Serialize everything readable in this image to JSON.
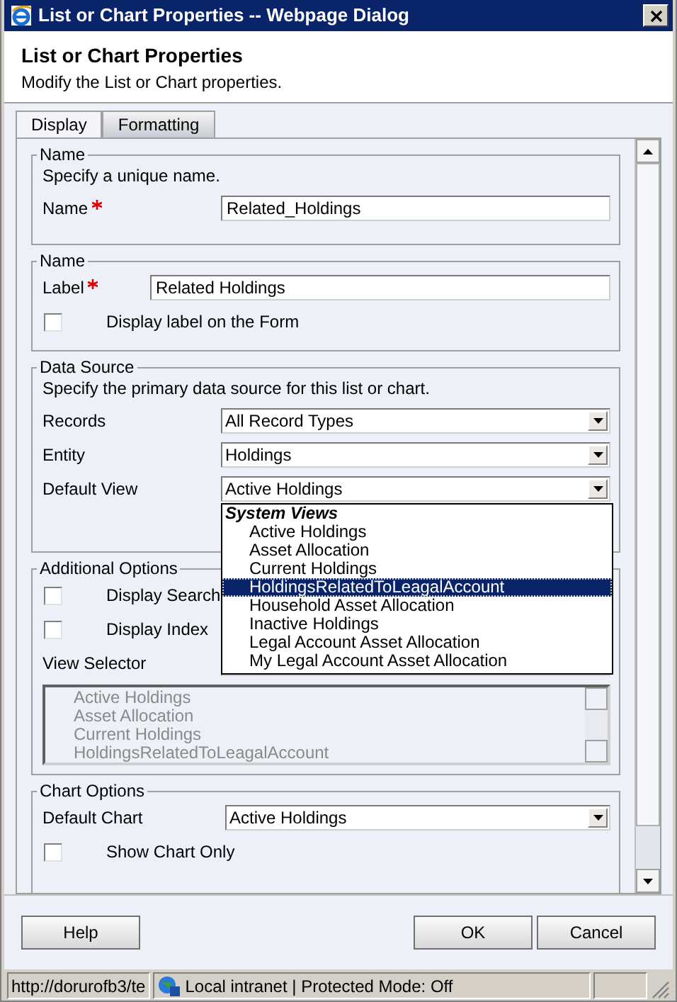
{
  "window": {
    "title": "List or Chart Properties -- Webpage Dialog"
  },
  "header": {
    "title": "List or Chart Properties",
    "subtitle": "Modify the List or Chart properties."
  },
  "tabs": [
    {
      "label": "Display",
      "selected": true
    },
    {
      "label": "Formatting",
      "selected": false
    }
  ],
  "sections": [
    {
      "legend": "Name",
      "description": "Specify a unique name.",
      "rows": [
        {
          "kind": "input",
          "label": "Name",
          "required": true,
          "value": "Related_Holdings"
        }
      ]
    },
    {
      "legend": "Name",
      "rows": [
        {
          "kind": "input",
          "label": "Label",
          "required": true,
          "value": "Related Holdings"
        },
        {
          "kind": "checkbox",
          "label": "Display label on the Form",
          "checked": false
        }
      ]
    },
    {
      "legend": "Data Source",
      "description": "Specify the primary data source for this list or chart.",
      "rows": [
        {
          "kind": "select",
          "label": "Records",
          "value": "All Record Types"
        },
        {
          "kind": "select",
          "label": "Entity",
          "value": "Holdings"
        },
        {
          "kind": "select",
          "label": "Default View",
          "value": "Active Holdings",
          "open": true
        }
      ]
    },
    {
      "legend": "Additional Options",
      "rows": [
        {
          "kind": "checkbox",
          "label": "Display Search",
          "checked": false
        },
        {
          "kind": "checkbox",
          "label": "Display Index",
          "checked": false
        },
        {
          "kind": "select",
          "label": "View Selector"
        },
        {
          "kind": "listbox",
          "disabled": true,
          "items": [
            "Active Holdings",
            "Asset Allocation",
            "Current Holdings",
            "HoldingsRelatedToLeagalAccount"
          ]
        }
      ]
    },
    {
      "legend": "Chart Options",
      "rows": [
        {
          "kind": "select",
          "label": "Default Chart",
          "value": "Active Holdings"
        },
        {
          "kind": "checkbox",
          "label": "Show Chart Only",
          "checked": false
        }
      ]
    }
  ],
  "dropdown": {
    "group": "System Views",
    "items": [
      {
        "label": "Active Holdings",
        "selected": false
      },
      {
        "label": "Asset Allocation",
        "selected": false
      },
      {
        "label": "Current Holdings",
        "selected": false
      },
      {
        "label": "HoldingsRelatedToLeagalAccount",
        "selected": true
      },
      {
        "label": "Household Asset Allocation",
        "selected": false
      },
      {
        "label": "Inactive Holdings",
        "selected": false
      },
      {
        "label": "Legal Account Asset Allocation",
        "selected": false
      },
      {
        "label": "My Legal Account Asset Allocation",
        "selected": false
      }
    ]
  },
  "buttons": {
    "left": [
      "Help"
    ],
    "right": [
      "OK",
      "Cancel"
    ]
  },
  "status_bar": {
    "url": "http://dorurofb3/te",
    "zone": "Local intranet | Protected Mode: Off"
  }
}
